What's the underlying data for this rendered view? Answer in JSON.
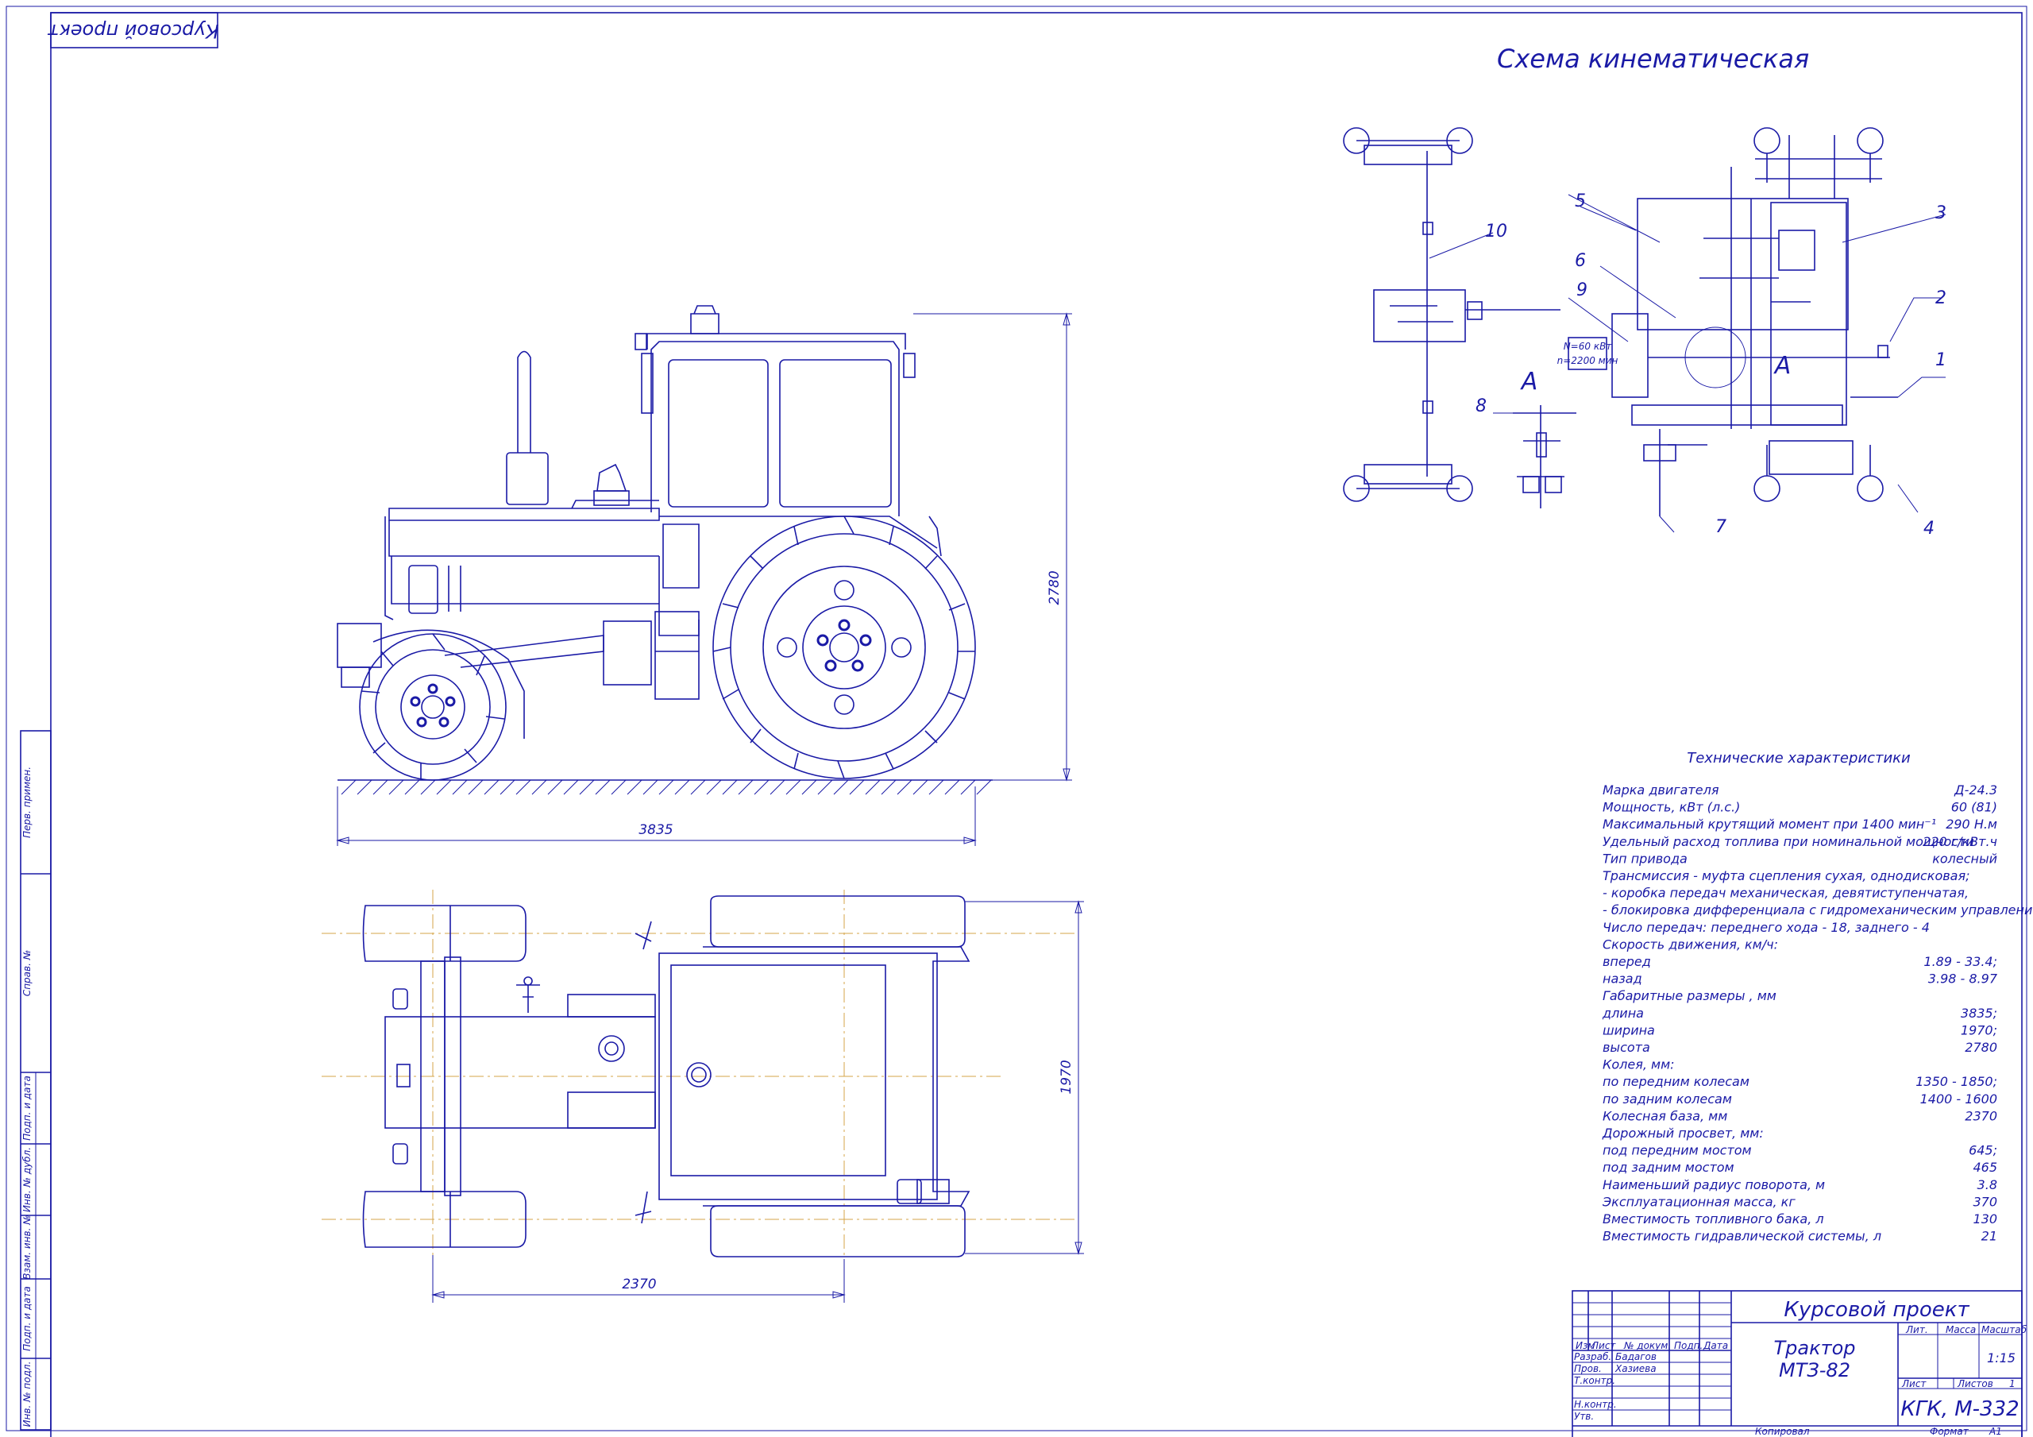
{
  "corner_stamp": "Курсовой проект",
  "scheme": {
    "title": "Схема кинематическая",
    "labels": [
      "1",
      "2",
      "3",
      "4",
      "5",
      "6",
      "7",
      "8",
      "9",
      "10"
    ],
    "detail_letter": "А",
    "engine_box_line1": "N=60 кВт",
    "engine_box_line2": "n=2200 мин"
  },
  "dimensions": {
    "length": "3835",
    "height": "2780",
    "width": "1970",
    "wheelbase": "2370"
  },
  "side_strip": [
    "Перв. примен.",
    "Справ. №",
    "Подп. и дата",
    "Инв. № дубл.",
    "Взам. инв. №",
    "Подп. и дата",
    "Инв. № подл."
  ],
  "specs": {
    "title": "Технические характеристики",
    "rows": [
      {
        "label": "Марка двигателя",
        "value": "Д-24.3"
      },
      {
        "label": "Мощность, кВт (л.с.)",
        "value": "60 (81)"
      },
      {
        "label": "Максимальный крутящий момент при 1400 мин⁻¹",
        "value": "290 Н.м"
      },
      {
        "label": "Удельный расход топлива при номинальной мощности",
        "value": "220 г/кВт.ч"
      },
      {
        "label": "Тип привода",
        "value": "колесный"
      },
      {
        "label": "Трансмиссия  - муфта сцепления сухая, однодисковая;",
        "value": ""
      },
      {
        "label": "- коробка передач механическая, девятиступенчатая,",
        "value": ""
      },
      {
        "label": "- блокировка дифференциала с гидромеханическим управлением;",
        "value": ""
      },
      {
        "label": "Число передач:  переднего хода - 18,  заднего - 4",
        "value": ""
      },
      {
        "label": "Скорость движения, км/ч:",
        "value": ""
      },
      {
        "label": "вперед",
        "value": "1.89 - 33.4;"
      },
      {
        "label": "назад",
        "value": "3.98 - 8.97"
      },
      {
        "label": "Габаритные размеры , мм",
        "value": ""
      },
      {
        "label": "длина",
        "value": "3835;"
      },
      {
        "label": "ширина",
        "value": "1970;"
      },
      {
        "label": "высота",
        "value": "2780"
      },
      {
        "label": "Колея, мм:",
        "value": ""
      },
      {
        "label": "по передним колесам",
        "value": "1350 - 1850;"
      },
      {
        "label": "по задним колесам",
        "value": "1400 - 1600"
      },
      {
        "label": "Колесная база, мм",
        "value": "2370"
      },
      {
        "label": "Дорожный просвет, мм:",
        "value": ""
      },
      {
        "label": "под передним мостом",
        "value": "645;"
      },
      {
        "label": "под задним мостом",
        "value": "465"
      },
      {
        "label": "Наименьший радиус поворота, м",
        "value": "3.8"
      },
      {
        "label": "Эксплуатационная масса, кг",
        "value": "370"
      },
      {
        "label": "Вместимость топливного бака, л",
        "value": "130"
      },
      {
        "label": "Вместимость гидравлической системы, л",
        "value": "21"
      }
    ]
  },
  "title_block": {
    "doc_title": "Курсовой проект",
    "product_line1": "Трактор",
    "product_line2": "МТЗ-82",
    "col_headers": [
      "Изм",
      "Лист",
      "№ докум.",
      "Подп.",
      "Дата"
    ],
    "roles": [
      "Разраб.",
      "Пров.",
      "Т.контр.",
      "",
      "Н.контр.",
      "Утв."
    ],
    "names": [
      "Бадагов",
      "Хазиева",
      "",
      "",
      "",
      ""
    ],
    "lit": "Лит.",
    "mass": "Масса",
    "scale_label": "Масштаб",
    "scale": "1:15",
    "sheet": "Лист",
    "sheets": "Листов",
    "sheets_count": "1",
    "org": "КГК, М-332",
    "copied": "Копировал",
    "format_label": "Формат",
    "format": "А1"
  }
}
